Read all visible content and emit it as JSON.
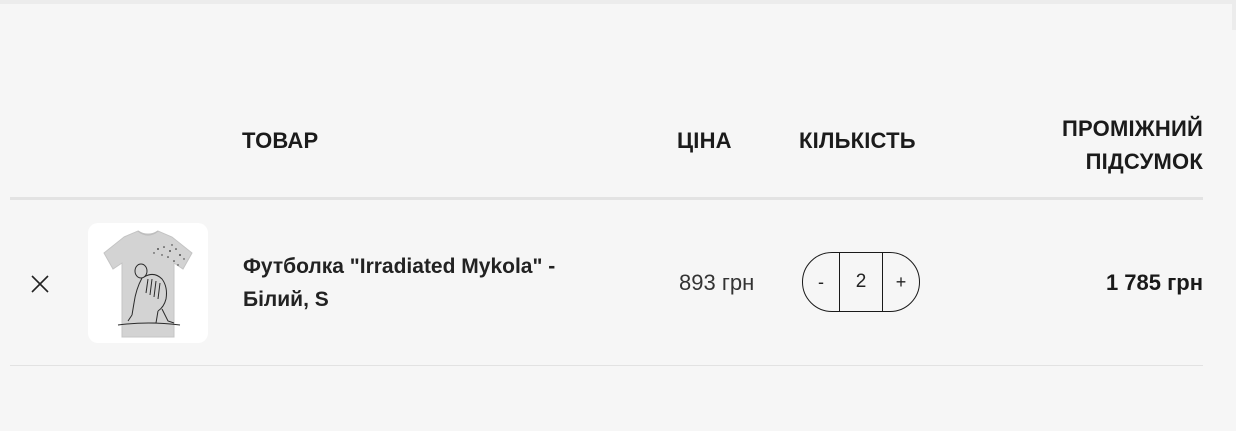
{
  "table": {
    "headers": {
      "product": "ТОВАР",
      "price": "ЦІНА",
      "quantity": "КІЛЬКІСТЬ",
      "subtotal_line1": "ПРОМІЖНИЙ",
      "subtotal_line2": "ПІДСУМОК"
    }
  },
  "items": [
    {
      "name_line1": "Футболка \"Irradiated Mykola\" -",
      "name_line2": "Білий, S",
      "image_icon": "tshirt-skeleton-image",
      "price": "893 грн",
      "quantity": "2",
      "decrease_label": "-",
      "increase_label": "+",
      "subtotal": "1 785 грн",
      "remove_icon": "close-icon"
    }
  ],
  "colors": {
    "background": "#f6f6f6",
    "text": "#1a1a1a",
    "divider": "#e3e3e3",
    "thumb_bg": "#ffffff"
  }
}
